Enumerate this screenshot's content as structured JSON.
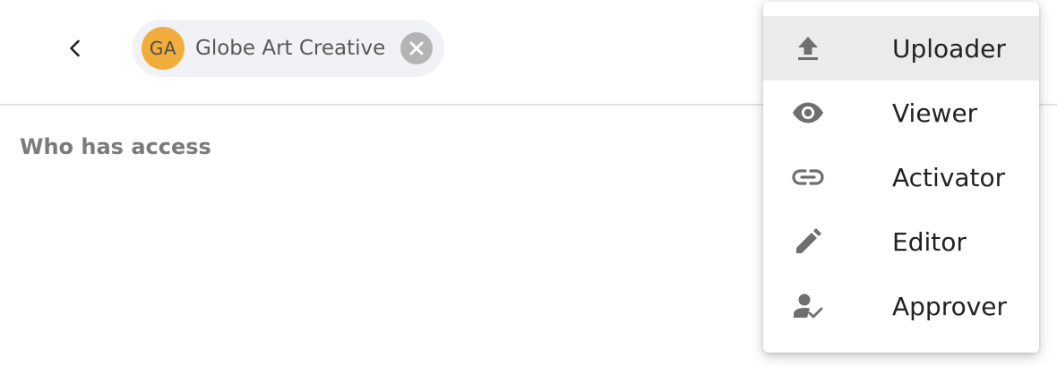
{
  "header": {
    "back_icon": "chevron-left-icon",
    "chip": {
      "initials": "GA",
      "name": "Globe Art Creative",
      "avatar_color": "#f0ad3c",
      "remove_icon": "close-circle-icon"
    }
  },
  "access": {
    "title": "Who has access"
  },
  "role_menu": {
    "items": [
      {
        "label": "Uploader",
        "icon": "upload-icon",
        "highlighted": true
      },
      {
        "label": "Viewer",
        "icon": "eye-icon",
        "highlighted": false
      },
      {
        "label": "Activator",
        "icon": "link-icon",
        "highlighted": false
      },
      {
        "label": "Editor",
        "icon": "pencil-icon",
        "highlighted": false
      },
      {
        "label": "Approver",
        "icon": "person-check-icon",
        "highlighted": false
      }
    ]
  }
}
